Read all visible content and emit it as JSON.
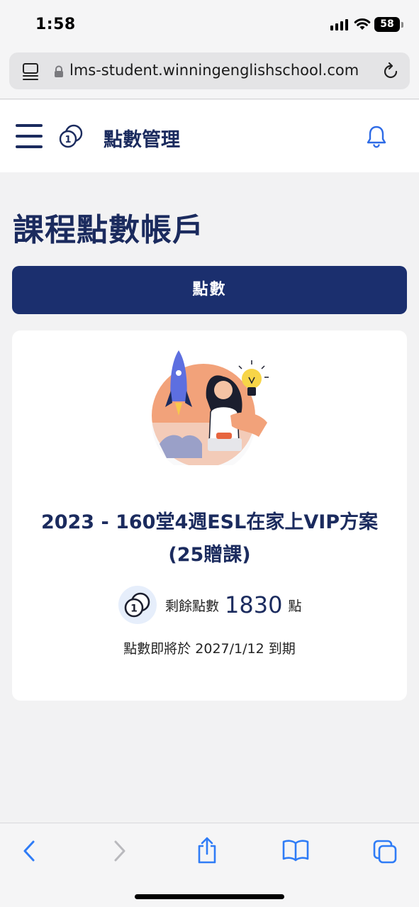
{
  "status_bar": {
    "time": "1:58",
    "battery": "58"
  },
  "browser": {
    "url": "lms-student.winningenglishschool.com"
  },
  "header": {
    "title": "點數管理"
  },
  "page": {
    "title": "課程點數帳戶",
    "tab_label": "點數"
  },
  "card": {
    "plan_name_line1": "2023 - 160堂4週ESL在家上VIP方案",
    "plan_name_line2": "(25贈課)",
    "points_label": "剩餘點數",
    "points_value": "1830",
    "points_unit": "點",
    "expiry_text": "點數即將於 2027/1/12 到期"
  },
  "icons": {
    "menu": "hamburger-icon",
    "coin": "coin-icon",
    "bell": "bell-icon",
    "back": "chevron-left-icon",
    "forward": "chevron-right-icon",
    "share": "share-icon",
    "bookmarks": "book-icon",
    "tabs": "tabs-icon"
  },
  "colors": {
    "primary": "#1b2f6e",
    "accent_text": "#1b2b5e",
    "safari_blue": "#2f7cf6"
  }
}
